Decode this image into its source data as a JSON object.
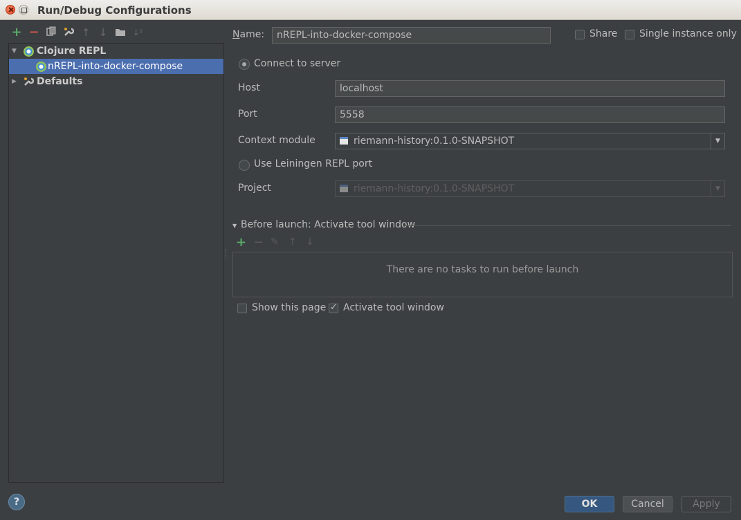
{
  "window": {
    "title": "Run/Debug Configurations"
  },
  "left_toolbar": {
    "icons": [
      "add-icon",
      "remove-icon",
      "copy-icon",
      "wrench-icon",
      "move-up-icon",
      "move-down-icon",
      "folder-icon",
      "sort-icon"
    ]
  },
  "tree": {
    "group_label": "Clojure REPL",
    "config_label": "nREPL-into-docker-compose",
    "defaults_label": "Defaults"
  },
  "form": {
    "name_label": "Name:",
    "name_value": "nREPL-into-docker-compose",
    "share_label": "Share",
    "single_instance_label": "Single instance only",
    "connect_server_label": "Connect to server",
    "host_label": "Host",
    "host_value": "localhost",
    "port_label": "Port",
    "port_value": "5558",
    "context_module_label": "Context module",
    "context_module_value": "riemann-history:0.1.0-SNAPSHOT",
    "lein_port_label": "Use Leiningen REPL port",
    "project_label": "Project",
    "project_value": "riemann-history:0.1.0-SNAPSHOT"
  },
  "before_launch": {
    "title": "Before launch: Activate tool window",
    "empty_text": "There are no tasks to run before launch",
    "show_page_label": "Show this page",
    "activate_tool_label": "Activate tool window"
  },
  "buttons": {
    "help": "?",
    "ok": "OK",
    "cancel": "Cancel",
    "apply": "Apply"
  },
  "colors": {
    "background": "#3c3f41",
    "selection": "#4b6eaf",
    "add_green": "#59a869",
    "remove_red": "#c75450",
    "ok_blue": "#365880"
  }
}
